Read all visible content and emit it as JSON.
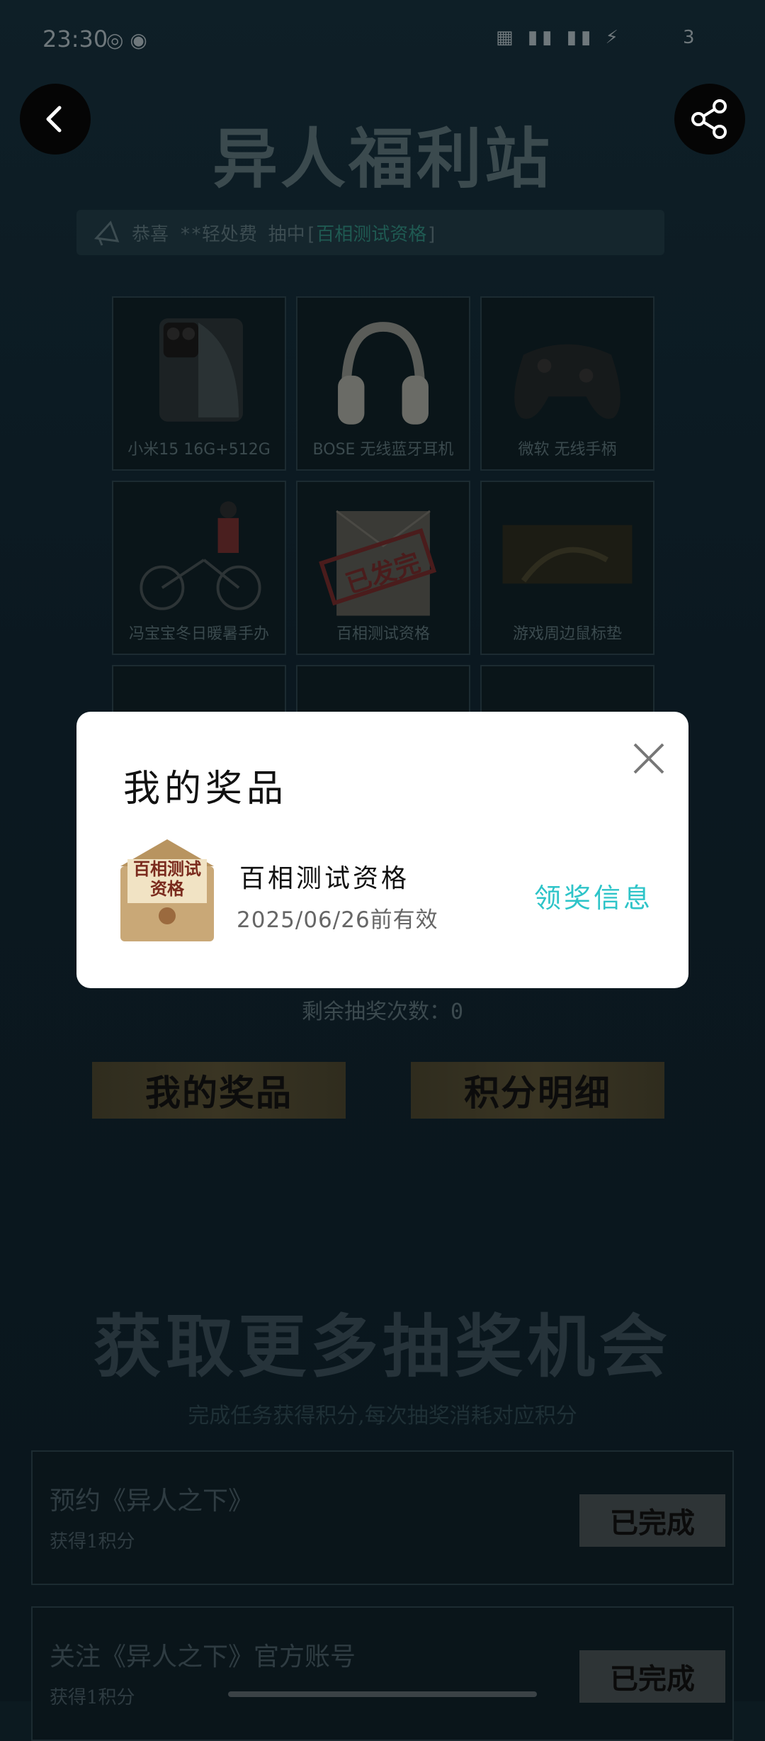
{
  "status_bar": {
    "time": "23:30",
    "battery": "3"
  },
  "header": {
    "title": "异人福利站"
  },
  "ticker": {
    "prefix": "恭喜 **轻处费 抽中[",
    "highlight": "百相测试资格",
    "suffix": "]"
  },
  "prizes": [
    {
      "label": "小米15 16G+512G",
      "icon": "phone-icon"
    },
    {
      "label": "BOSE 无线蓝牙耳机",
      "icon": "headphones-icon"
    },
    {
      "label": "微软 无线手柄",
      "icon": "gamepad-icon"
    },
    {
      "label": "冯宝宝冬日暖暑手办",
      "icon": "figure-icon"
    },
    {
      "label": "百相测试资格",
      "icon": "envelope-icon",
      "stamp": "已发完"
    },
    {
      "label": "游戏周边鼠标垫",
      "icon": "mousepad-icon"
    }
  ],
  "lottery": {
    "remaining_label": "剩余抽奖次数：0",
    "my_prizes_button": "我的奖品",
    "points_button": "积分明细"
  },
  "more": {
    "title": "获取更多抽奖机会",
    "subtitle": "完成任务获得积分,每次抽奖消耗对应积分"
  },
  "tasks": [
    {
      "title": "预约《异人之下》",
      "reward": "获得1积分",
      "status": "已完成"
    },
    {
      "title": "关注《异人之下》官方账号",
      "reward": "获得1积分",
      "status": "已完成"
    }
  ],
  "modal": {
    "title": "我的奖品",
    "item_name": "百相测试资格",
    "item_image_text": "百相测试资格",
    "item_valid": "2025/06/26前有效",
    "claim_label": "领奖信息"
  }
}
